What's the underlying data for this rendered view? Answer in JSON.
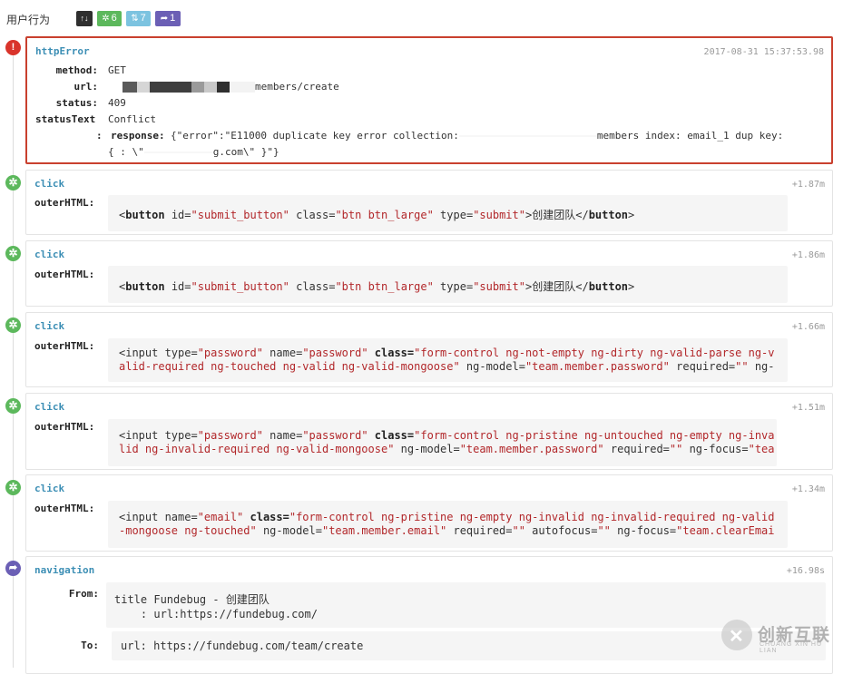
{
  "header": {
    "title": "用户行为",
    "badges": {
      "sort_glyph": "↑↓",
      "click_count": "6",
      "request_count": "7",
      "navigation_count": "1"
    }
  },
  "events": {
    "error": {
      "type": "httpError",
      "timestamp": "2017-08-31 15:37:53.98",
      "method_key": "method:",
      "method": "GET",
      "url_key": "url:",
      "url_tail": "members/create",
      "status_key": "status:",
      "status": "409",
      "status_text_key": "statusText",
      "status_text": "Conflict",
      "response_colon": ":",
      "response_key": "response:",
      "response_line1_a": "{\"error\":\"E11000 duplicate key error collection:",
      "response_line1_b": "members index: email_1 dup key:",
      "response_line2_a": "{ : \\\"",
      "response_line2_b": "g.com\\\" }\"}"
    },
    "click1": {
      "type": "click",
      "timestamp": "+1.87m",
      "key": "outerHTML:",
      "code": {
        "open": "<",
        "tag": "button",
        "attrs": [
          {
            "name": " id=",
            "value": "\"submit_button\""
          },
          {
            "name": " class=",
            "value": "\"btn btn_large\""
          },
          {
            "name": " type=",
            "value": "\"submit\""
          }
        ],
        "gt": ">",
        "text": "创建团队",
        "close_open": "</",
        "close_tag": "button",
        "close_gt": ">"
      }
    },
    "click2": {
      "type": "click",
      "timestamp": "+1.86m",
      "key": "outerHTML:",
      "code": {
        "open": "<",
        "tag": "button",
        "attrs": [
          {
            "name": " id=",
            "value": "\"submit_button\""
          },
          {
            "name": " class=",
            "value": "\"btn btn_large\""
          },
          {
            "name": " type=",
            "value": "\"submit\""
          }
        ],
        "gt": ">",
        "text": "创建团队",
        "close_open": "</",
        "close_tag": "button",
        "close_gt": ">"
      }
    },
    "click3": {
      "type": "click",
      "timestamp": "+1.66m",
      "key": "outerHTML:",
      "l1_a": "<input type=",
      "l1_b": "\"password\"",
      "l1_c": " name=",
      "l1_d": "\"password\"",
      "l1_e": " class=",
      "l1_f": "\"form-control ng-not-empty ng-dirty ng-valid-parse ng-v",
      "l2_a": "alid-required ng-touched ng-valid ng-valid-mongoose\"",
      "l2_b": " ng-model=",
      "l2_c": "\"team.member.password\"",
      "l2_d": " required=",
      "l2_e": "\"\"",
      "l2_f": " ng-"
    },
    "click4": {
      "type": "click",
      "timestamp": "+1.51m",
      "key": "outerHTML:",
      "l1_a": "<input type=",
      "l1_b": "\"password\"",
      "l1_c": " name=",
      "l1_d": "\"password\"",
      "l1_e": " class=",
      "l1_f": "\"form-control ng-pristine ng-untouched ng-empty ng-inva",
      "l2_a": "lid ng-invalid-required ng-valid-mongoose\"",
      "l2_b": " ng-model=",
      "l2_c": "\"team.member.password\"",
      "l2_d": " required=",
      "l2_e": "\"\"",
      "l2_f": " ng-focus=",
      "l2_g": "\"tea"
    },
    "click5": {
      "type": "click",
      "timestamp": "+1.34m",
      "key": "outerHTML:",
      "l1_a": "<input name=",
      "l1_b": "\"email\"",
      "l1_c": " class=",
      "l1_d": "\"form-control ng-pristine ng-empty ng-invalid ng-invalid-required ng-valid",
      "l2_a": "-mongoose ng-touched\"",
      "l2_b": " ng-model=",
      "l2_c": "\"team.member.email\"",
      "l2_d": " required=",
      "l2_e": "\"\"",
      "l2_f": " autofocus=",
      "l2_g": "\"\"",
      "l2_h": " ng-focus=",
      "l2_i": "\"team.clearEmai"
    },
    "navigation": {
      "type": "navigation",
      "timestamp": "+16.98s",
      "from_key": "From:",
      "from_line1": "title Fundebug - 创建团队",
      "from_line2": "    : url:https://fundebug.com/",
      "to_key": "To:",
      "to_line1": "url: https://fundebug.com/team/create"
    }
  },
  "watermark": {
    "name": "创新互联",
    "sub": "CHUANG XIN HU LIAN"
  }
}
